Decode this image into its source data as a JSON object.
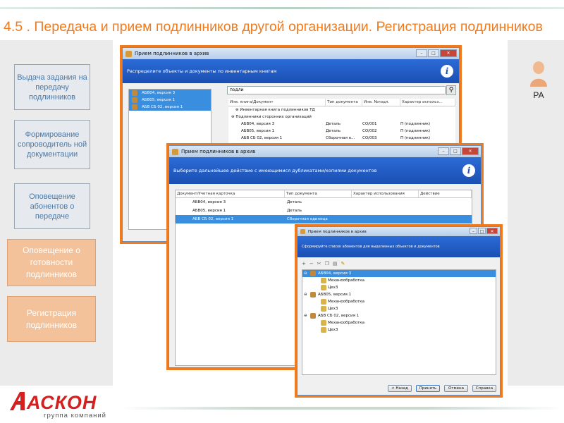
{
  "slide_title": "4.5 . Передача и прием подлинников другой организации. Регистрация подлинников",
  "steps": [
    {
      "label": "Выдача задания на передачу подлинников",
      "state": "inactive"
    },
    {
      "label": "Формирование сопроводитель ной документации",
      "state": "inactive"
    },
    {
      "label": "Оповещение абонентов о передаче",
      "state": "inactive"
    },
    {
      "label": "Оповещение о готовности подлинников",
      "state": "active"
    },
    {
      "label": "Регистрация подлинников",
      "state": "active"
    }
  ],
  "role": {
    "label": "РА",
    "icon": "user-icon"
  },
  "colors": {
    "accent_orange": "#f07a1e",
    "step_blue_text": "#4a79a8",
    "dialog_header_blue": "#1a4fb3",
    "selection_blue": "#3a8ee0",
    "logo_red": "#d61f1f"
  },
  "window1": {
    "title": "Прием подлинников в архив",
    "header": "Распределите объекты и документы по инвентарным книгам",
    "left_items": [
      "АБВ04, версия 3",
      "АБВ05, версия 1",
      "АБВ СБ 02, версия 1"
    ],
    "search_value": "подли",
    "columns": [
      "Инв. книга/Документ",
      "Тип документа",
      "Инв. №подл.",
      "Характер использ..."
    ],
    "rows": [
      {
        "name": "Инвентарная книга подлинников ТД",
        "type": "",
        "inv": "",
        "usage": ""
      },
      {
        "name": "Подлинники сторонних организаций",
        "type": "",
        "inv": "",
        "usage": ""
      },
      {
        "name": "АБВ04, версия 3",
        "type": "Деталь",
        "inv": "СО/001",
        "usage": "П (подлинник)"
      },
      {
        "name": "АБВ05, версия 1",
        "type": "Деталь",
        "inv": "СО/002",
        "usage": "П (подлинник)"
      },
      {
        "name": "АБВ СБ 02, версия 1",
        "type": "Сборочная е...",
        "inv": "СО/003",
        "usage": "П (подлинник)"
      }
    ]
  },
  "window2": {
    "title": "Прием подлинников в архив",
    "header": "Выберите дальнейшее действие с имеющимися дубликатами/копиями документов",
    "columns": [
      "Документ/Учетная карточка",
      "Тип документа",
      "Характер использования",
      "Действие"
    ],
    "rows": [
      {
        "name": "АБВ04, версия 3",
        "type": "Деталь"
      },
      {
        "name": "АБВ05, версия 1",
        "type": "Деталь"
      },
      {
        "name": "АБВ СБ 02, версия 1",
        "type": "Сборочная единица"
      }
    ]
  },
  "window3": {
    "title": "Прием подлинников в архив",
    "header": "Сформируйте список абонентов для выделенных объектов и документов",
    "tree": [
      {
        "name": "АБВ04, версия 3",
        "children": [
          "Механообработка",
          "Цех3"
        ]
      },
      {
        "name": "АБВ05, версия 1",
        "children": [
          "Механообработка",
          "Цех3"
        ]
      },
      {
        "name": "АБВ СБ 02, версия 1",
        "children": [
          "Механообработка",
          "Цех3"
        ]
      }
    ],
    "buttons": {
      "back": "< Назад",
      "apply": "Принять",
      "cancel": "Отмена",
      "help": "Справка"
    }
  },
  "logo": {
    "name": "АСКОН",
    "subtitle": "группа компаний"
  }
}
